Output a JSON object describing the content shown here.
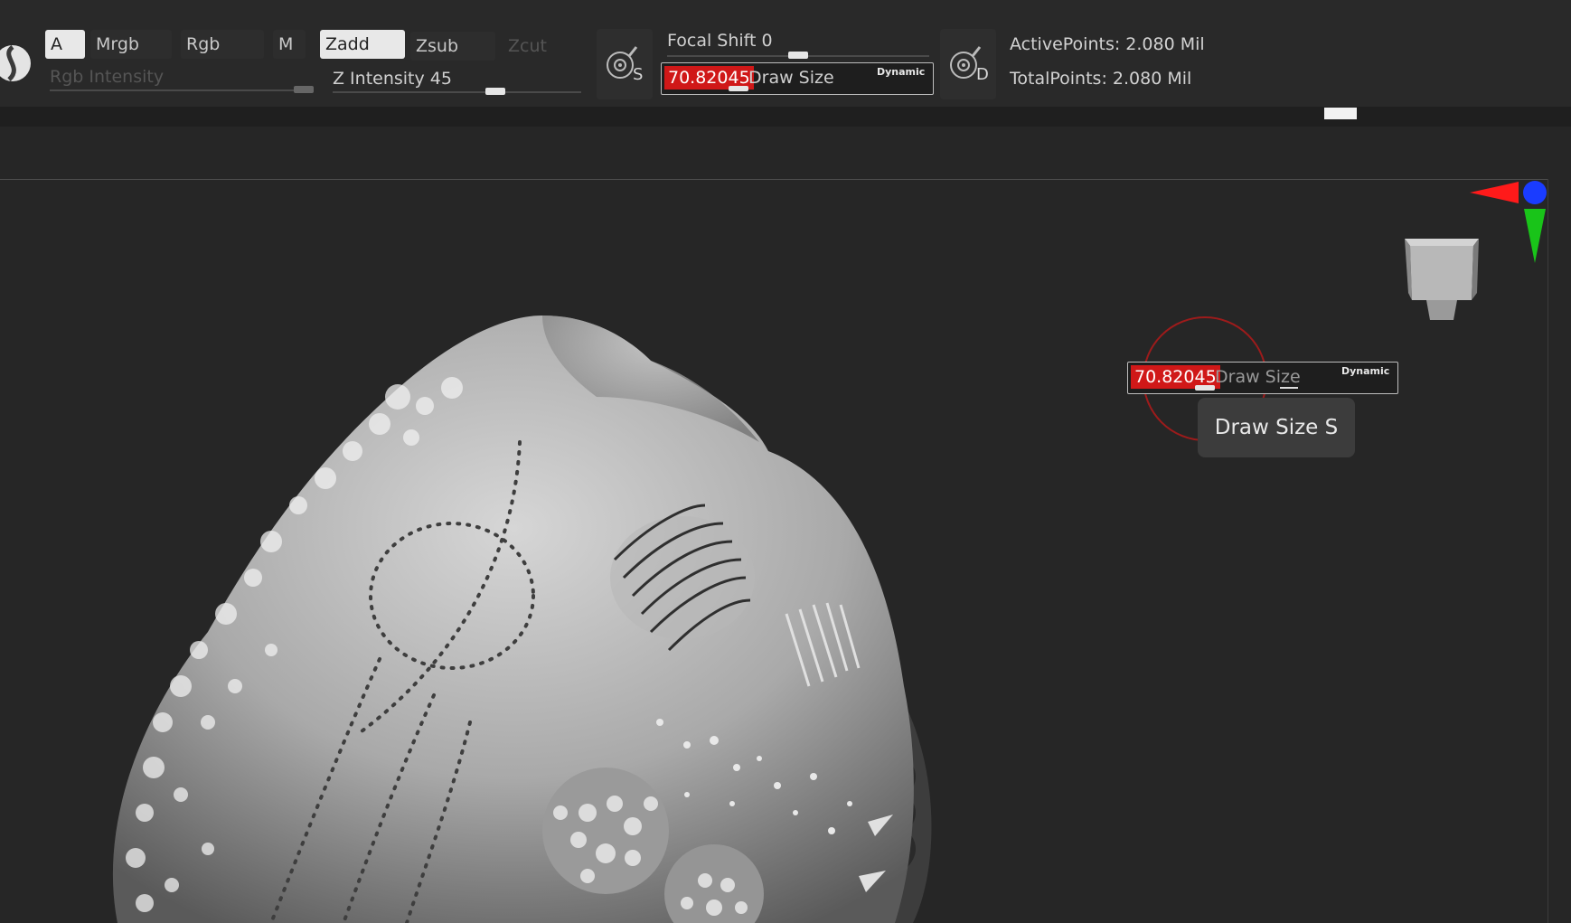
{
  "toolbar": {
    "modes": {
      "a": "A",
      "mrgb": "Mrgb",
      "rgb": "Rgb",
      "m": "M",
      "zadd": "Zadd",
      "zsub": "Zsub",
      "zcut": "Zcut"
    },
    "rgb_intensity_label": "Rgb Intensity",
    "z_intensity_label": "Z Intensity 45",
    "focal_shift_label": "Focal Shift 0",
    "draw_size": {
      "value": "70.82045",
      "label": "Draw Size",
      "dynamic": "Dynamic"
    },
    "s_icon_letter": "S",
    "d_icon_letter": "D",
    "active_points": "ActivePoints: 2.080 Mil",
    "total_points": "TotalPoints: 2.080 Mil"
  },
  "viewport": {
    "floating_draw_size": {
      "value": "70.82045",
      "label": "Draw Size",
      "dynamic": "Dynamic"
    },
    "tooltip": "Draw Size  S",
    "gizmo_colors": {
      "x": "#ff1a1a",
      "y": "#19c419",
      "z": "#1a3cff"
    }
  },
  "colors": {
    "value_highlight": "#d01818",
    "background": "#262626"
  }
}
